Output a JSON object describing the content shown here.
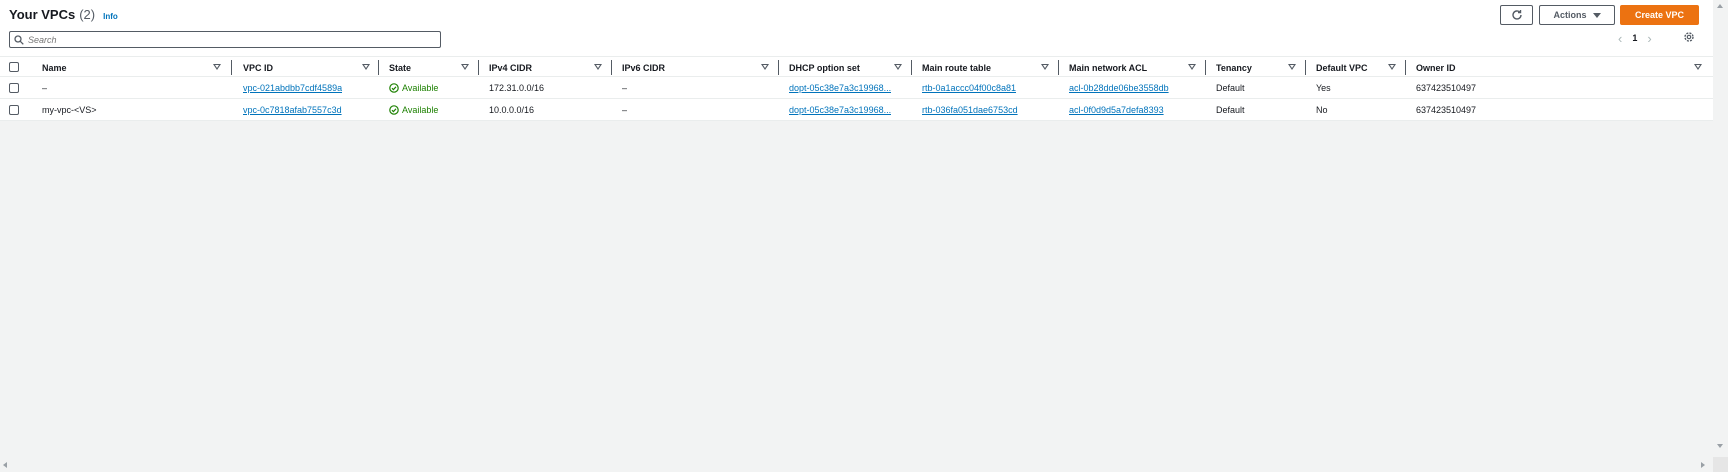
{
  "header": {
    "title": "Your VPCs",
    "count": "(2)",
    "info": "Info"
  },
  "toolbar": {
    "actions_label": "Actions",
    "create_label": "Create VPC"
  },
  "search": {
    "placeholder": "Search",
    "value": ""
  },
  "pagination": {
    "current_page": "1"
  },
  "columns": [
    "Name",
    "VPC ID",
    "State",
    "IPv4 CIDR",
    "IPv6 CIDR",
    "DHCP option set",
    "Main route table",
    "Main network ACL",
    "Tenancy",
    "Default VPC",
    "Owner ID"
  ],
  "rows": [
    {
      "name": "–",
      "vpc_id": "vpc-021abdbb7cdf4589a",
      "state": "Available",
      "ipv4_cidr": "172.31.0.0/16",
      "ipv6_cidr": "–",
      "dhcp_option_set": "dopt-05c38e7a3c19968...",
      "main_route_table": "rtb-0a1accc04f00c8a81",
      "main_network_acl": "acl-0b28dde06be3558db",
      "tenancy": "Default",
      "default_vpc": "Yes",
      "owner_id": "637423510497"
    },
    {
      "name": "my-vpc-<VS>",
      "vpc_id": "vpc-0c7818afab7557c3d",
      "state": "Available",
      "ipv4_cidr": "10.0.0.0/16",
      "ipv6_cidr": "–",
      "dhcp_option_set": "dopt-05c38e7a3c19968...",
      "main_route_table": "rtb-036fa051dae6753cd",
      "main_network_acl": "acl-0f0d9d5a7defa8393",
      "tenancy": "Default",
      "default_vpc": "No",
      "owner_id": "637423510497"
    }
  ],
  "colors": {
    "accent": "#ec7211",
    "link": "#0073bb",
    "success": "#1d8102"
  }
}
